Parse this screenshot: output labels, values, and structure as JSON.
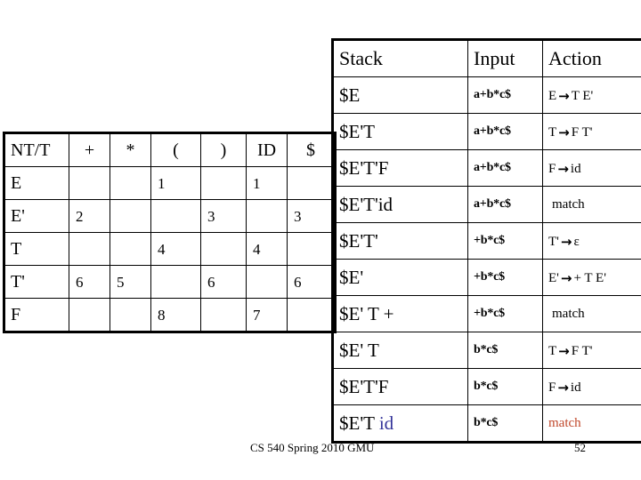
{
  "parse_table": {
    "headers": [
      "NT/T",
      "+",
      "*",
      "(",
      ")",
      "ID",
      "$"
    ],
    "rows": [
      {
        "nt": "E",
        "cells": [
          "",
          "",
          "1",
          "",
          "1",
          ""
        ]
      },
      {
        "nt": "E'",
        "cells": [
          "2",
          "",
          "",
          "3",
          "",
          "3"
        ]
      },
      {
        "nt": "T",
        "cells": [
          "",
          "",
          "4",
          "",
          "4",
          ""
        ]
      },
      {
        "nt": "T'",
        "cells": [
          "6",
          "5",
          "",
          "6",
          "",
          "6"
        ]
      },
      {
        "nt": "F",
        "cells": [
          "",
          "",
          "8",
          "",
          "7",
          ""
        ]
      }
    ]
  },
  "trace_table": {
    "headers": {
      "stack": "Stack",
      "input": "Input",
      "action": "Action"
    },
    "rows": [
      {
        "stack": "$E",
        "input": "a+b*c$",
        "action_lhs": "E",
        "action_arrow": "→",
        "action_rhs": "T E'",
        "highlight": false
      },
      {
        "stack": "$E'T",
        "input": "a+b*c$",
        "action_lhs": "T",
        "action_arrow": "→",
        "action_rhs": "F T'",
        "highlight": false
      },
      {
        "stack": "$E'T'F",
        "input": "a+b*c$",
        "action_lhs": "F",
        "action_arrow": "→",
        "action_rhs": "id",
        "highlight": false
      },
      {
        "stack": "$E'T'id",
        "input": "a+b*c$",
        "action_lhs": "",
        "action_arrow": "",
        "action_rhs": "match",
        "highlight": false
      },
      {
        "stack": "$E'T'",
        "input": "+b*c$",
        "action_lhs": "T'",
        "action_arrow": "→",
        "action_rhs": "ε",
        "highlight": false
      },
      {
        "stack": "$E'",
        "input": "+b*c$",
        "action_lhs": "E'",
        "action_arrow": "→",
        "action_rhs": "+ T E'",
        "highlight": false
      },
      {
        "stack": "$E' T +",
        "input": "+b*c$",
        "action_lhs": "",
        "action_arrow": "",
        "action_rhs": "match",
        "highlight": false
      },
      {
        "stack": "$E' T",
        "input": "b*c$",
        "action_lhs": "T",
        "action_arrow": "→",
        "action_rhs": "F T'",
        "highlight": false
      },
      {
        "stack": "$E'T'F",
        "input": "b*c$",
        "action_lhs": "F",
        "action_arrow": "→",
        "action_rhs": "id",
        "highlight": false
      },
      {
        "stack": "$E'T ",
        "stack_hl": "id",
        "input": "b*c$",
        "action_lhs": "",
        "action_arrow": "",
        "action_rhs": "match",
        "highlight": true
      }
    ]
  },
  "footer": {
    "credit": "CS 540 Spring 2010 GMU",
    "page": "52"
  },
  "colors": {
    "highlight_blue": "#333399",
    "highlight_red": "#C0472A",
    "border": "#000000",
    "background": "#FFFFFF"
  }
}
